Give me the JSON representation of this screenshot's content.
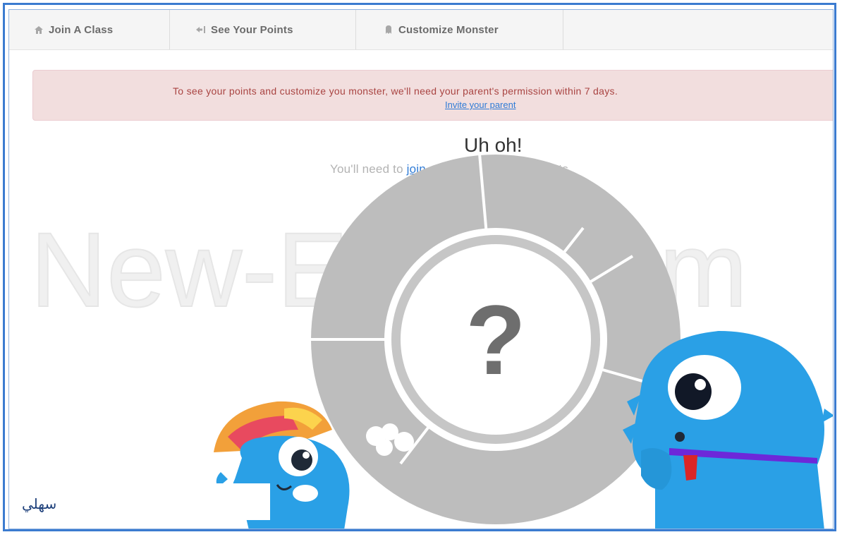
{
  "nav": {
    "tabs": [
      {
        "label": "Join A Class",
        "icon": "home-icon"
      },
      {
        "label": "See Your Points",
        "icon": "points-icon"
      },
      {
        "label": "Customize Monster",
        "icon": "monster-icon"
      }
    ]
  },
  "alert": {
    "message": "To see your points and customize you monster, we'll need your parent's permission within 7 days.",
    "link": "Invite your parent"
  },
  "main": {
    "headline": "Uh oh!",
    "sub_prefix": "You'll need to",
    "sub_link": "join a class",
    "sub_suffix": "to see your points.",
    "wheel_symbol": "?"
  },
  "watermark": "New-Educ.com",
  "corner_text": "سهلي",
  "colors": {
    "frame": "#3b7bd0",
    "alert_bg": "#f2dede",
    "alert_text": "#a94442",
    "link": "#2f7bd6",
    "wheel": "#bdbdbd",
    "monster": "#2aa0e6"
  }
}
